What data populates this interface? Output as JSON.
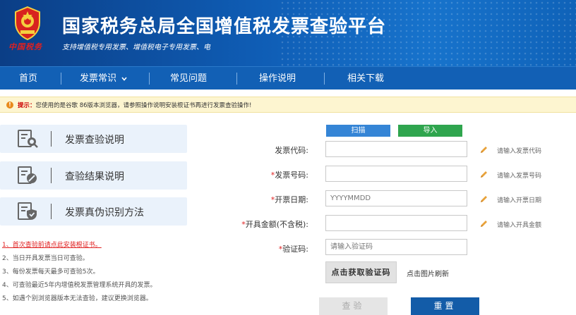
{
  "header": {
    "title": "国家税务总局全国增值税发票查验平台",
    "subtitle": "支持增值税专用发票、增值税电子专用发票、电",
    "seal_text": "中国税务"
  },
  "nav": {
    "items": [
      {
        "label": "首页"
      },
      {
        "label": "发票常识"
      },
      {
        "label": "常见问题"
      },
      {
        "label": "操作说明"
      },
      {
        "label": "相关下载"
      }
    ]
  },
  "notice": {
    "prefix": "提示：",
    "text": "您使用的是谷歌 86版本浏览器，请参照操作说明安装根证书再进行发票查验操作!"
  },
  "side_menu": [
    {
      "label": "发票查验说明",
      "icon": "document-search-icon"
    },
    {
      "label": "查验结果说明",
      "icon": "document-edit-icon"
    },
    {
      "label": "发票真伪识别方法",
      "icon": "document-shield-icon"
    }
  ],
  "tips": [
    "1、首次查验前请点此安装根证书。",
    "2、当日开具发票当日可查验。",
    "3、每份发票每天最多可查验5次。",
    "4、可查验最近5年内增值税发票管理系统开具的发票。",
    "5、如遇个别浏览器版本无法查验，建议更换浏览器。"
  ],
  "form": {
    "scan_label": "扫描",
    "import_label": "导入",
    "fields": [
      {
        "label": "发票代码:",
        "required": "",
        "placeholder": "",
        "hint": "请输入发票代码"
      },
      {
        "label": "发票号码:",
        "required": "*",
        "placeholder": "",
        "hint": "请输入发票号码"
      },
      {
        "label": "开票日期:",
        "required": "*",
        "placeholder": "YYYYMMDD",
        "hint": "请输入开票日期"
      },
      {
        "label": "开具金额(不含税):",
        "required": "*",
        "placeholder": "",
        "hint": "请输入开具金额"
      },
      {
        "label": "验证码:",
        "required": "*",
        "placeholder": "请输入验证码",
        "hint": ""
      }
    ],
    "captcha_text": "点击获取验证码",
    "refresh_text": "点击图片刷新",
    "check_label": "查验",
    "reset_label": "重置"
  },
  "colors": {
    "nav_blue": "#1260b5",
    "accent_red": "#e02020",
    "scan_blue": "#3585d6",
    "import_green": "#2fa54e",
    "reset_blue": "#135ca8"
  }
}
